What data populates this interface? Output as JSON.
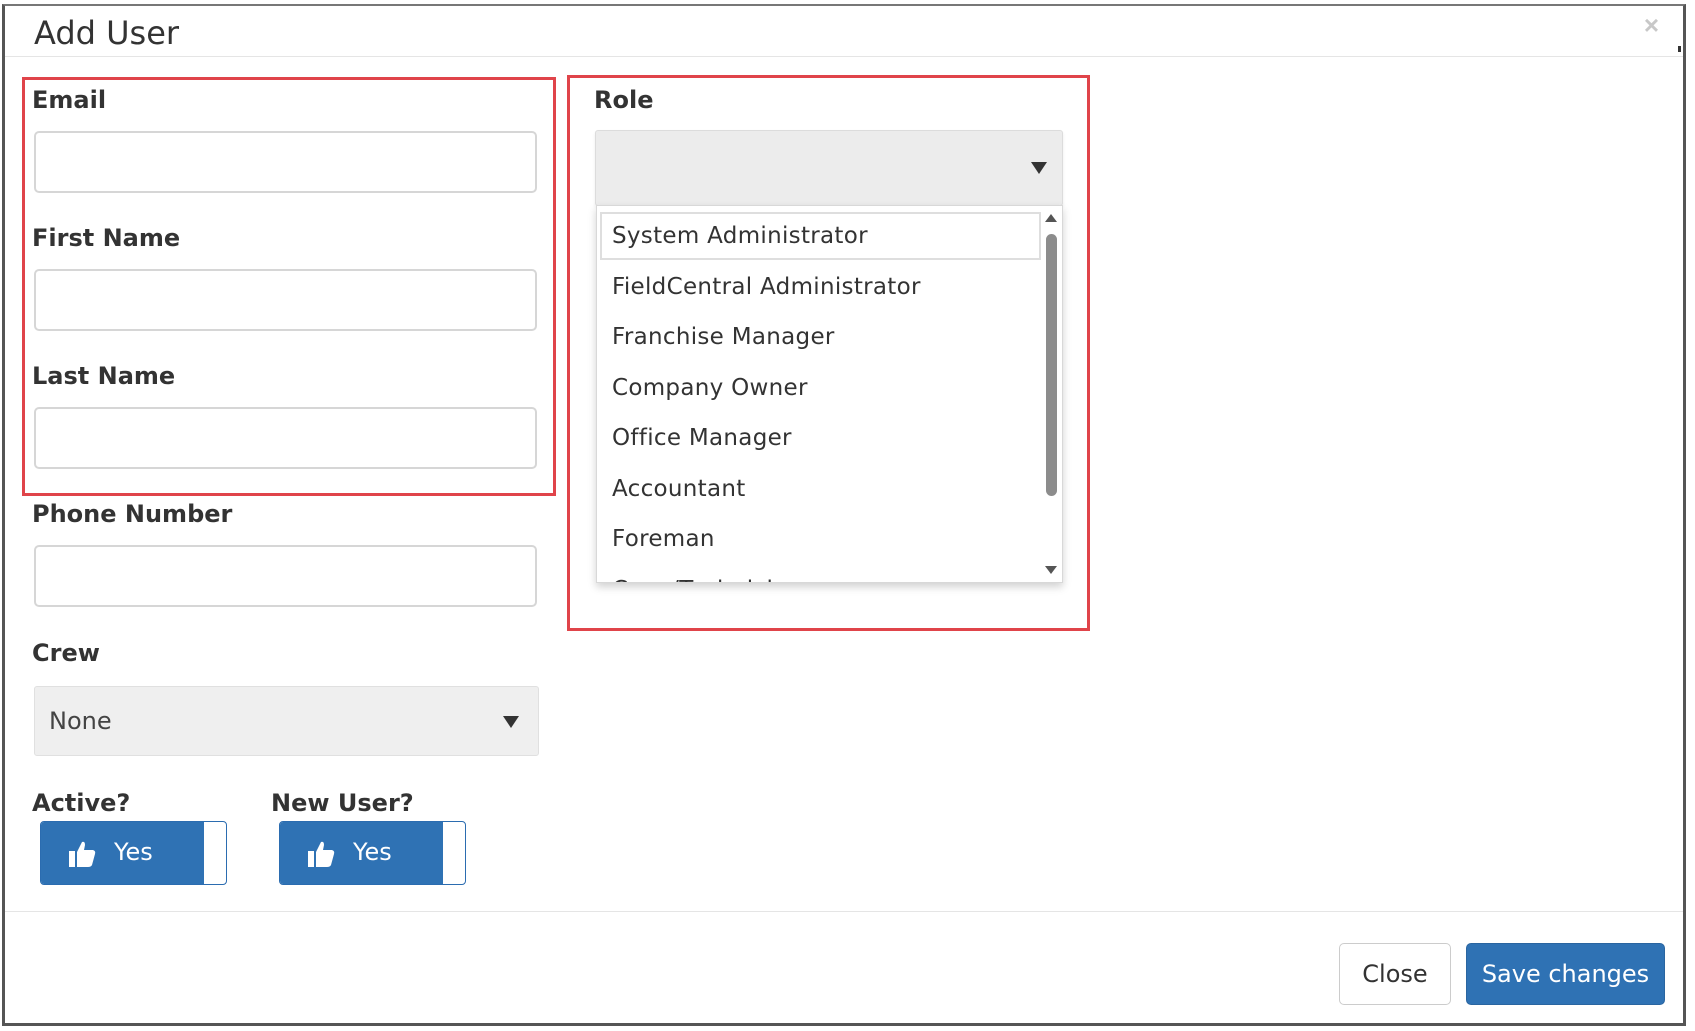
{
  "modal": {
    "title": "Add User",
    "close_glyph": "×"
  },
  "fields": {
    "email": {
      "label": "Email",
      "value": ""
    },
    "first_name": {
      "label": "First Name",
      "value": ""
    },
    "last_name": {
      "label": "Last Name",
      "value": ""
    },
    "phone": {
      "label": "Phone Number",
      "value": ""
    }
  },
  "crew": {
    "label": "Crew",
    "selected": "None"
  },
  "role": {
    "label": "Role",
    "selected": "",
    "options": [
      "System Administrator",
      "FieldCentral Administrator",
      "Franchise Manager",
      "Company Owner",
      "Office Manager",
      "Accountant",
      "Foreman",
      "Crew/Technician"
    ],
    "highlighted_option": "System Administrator"
  },
  "toggles": {
    "active": {
      "label": "Active?",
      "state": "Yes",
      "icon": "thumbs-up-icon"
    },
    "new_user": {
      "label": "New User?",
      "state": "Yes",
      "icon": "thumbs-up-icon"
    }
  },
  "footer": {
    "close_label": "Close",
    "save_label": "Save changes"
  },
  "colors": {
    "primary": "#2f72b4",
    "highlight_border": "#e0444a",
    "select_bg": "#efefef"
  }
}
